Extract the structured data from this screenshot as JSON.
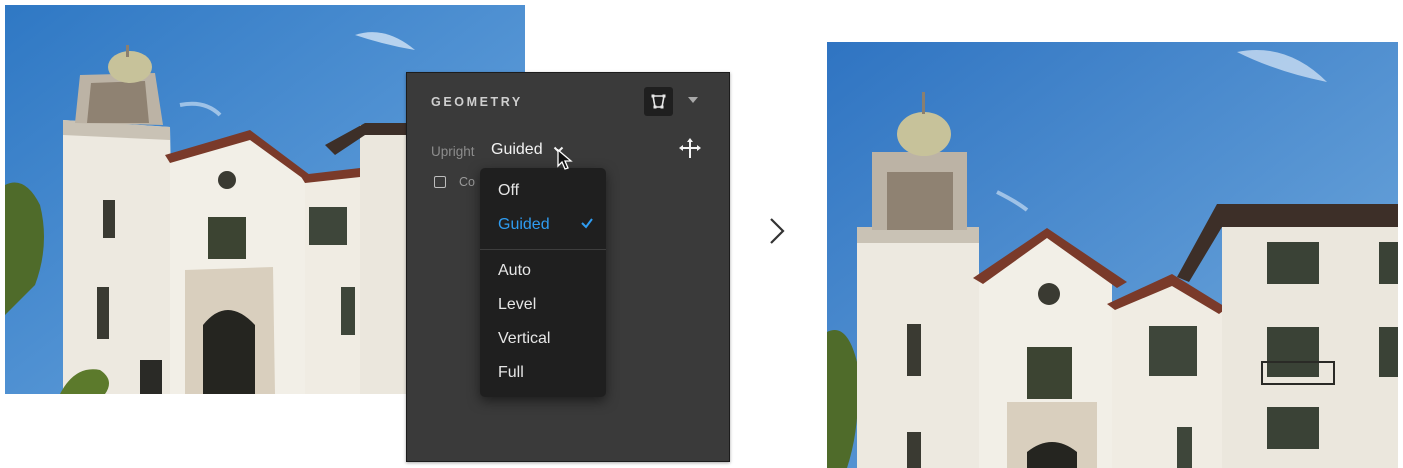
{
  "panel": {
    "title": "GEOMETRY",
    "upright": {
      "label": "Upright",
      "value": "Guided"
    },
    "constrain_label": "Co",
    "dropdown": {
      "options": [
        "Off",
        "Guided",
        "Auto",
        "Level",
        "Vertical",
        "Full"
      ],
      "selected": "Guided"
    }
  },
  "colors": {
    "panel_bg": "#3a3a3a",
    "menu_bg": "#1f1f1f",
    "accent": "#2f9cf1",
    "sky": "#3d84cc",
    "building": "#ece8df",
    "roof": "#7a3a2a"
  },
  "icons": {
    "geometry_tool": "geometry-transform-icon",
    "collapse": "caret-down-icon",
    "upright_toggle": "chevron-down-icon",
    "move": "move-arrows-icon",
    "pointer": "mouse-cursor-icon",
    "check": "checkmark-icon",
    "transition": "chevron-right-icon"
  }
}
